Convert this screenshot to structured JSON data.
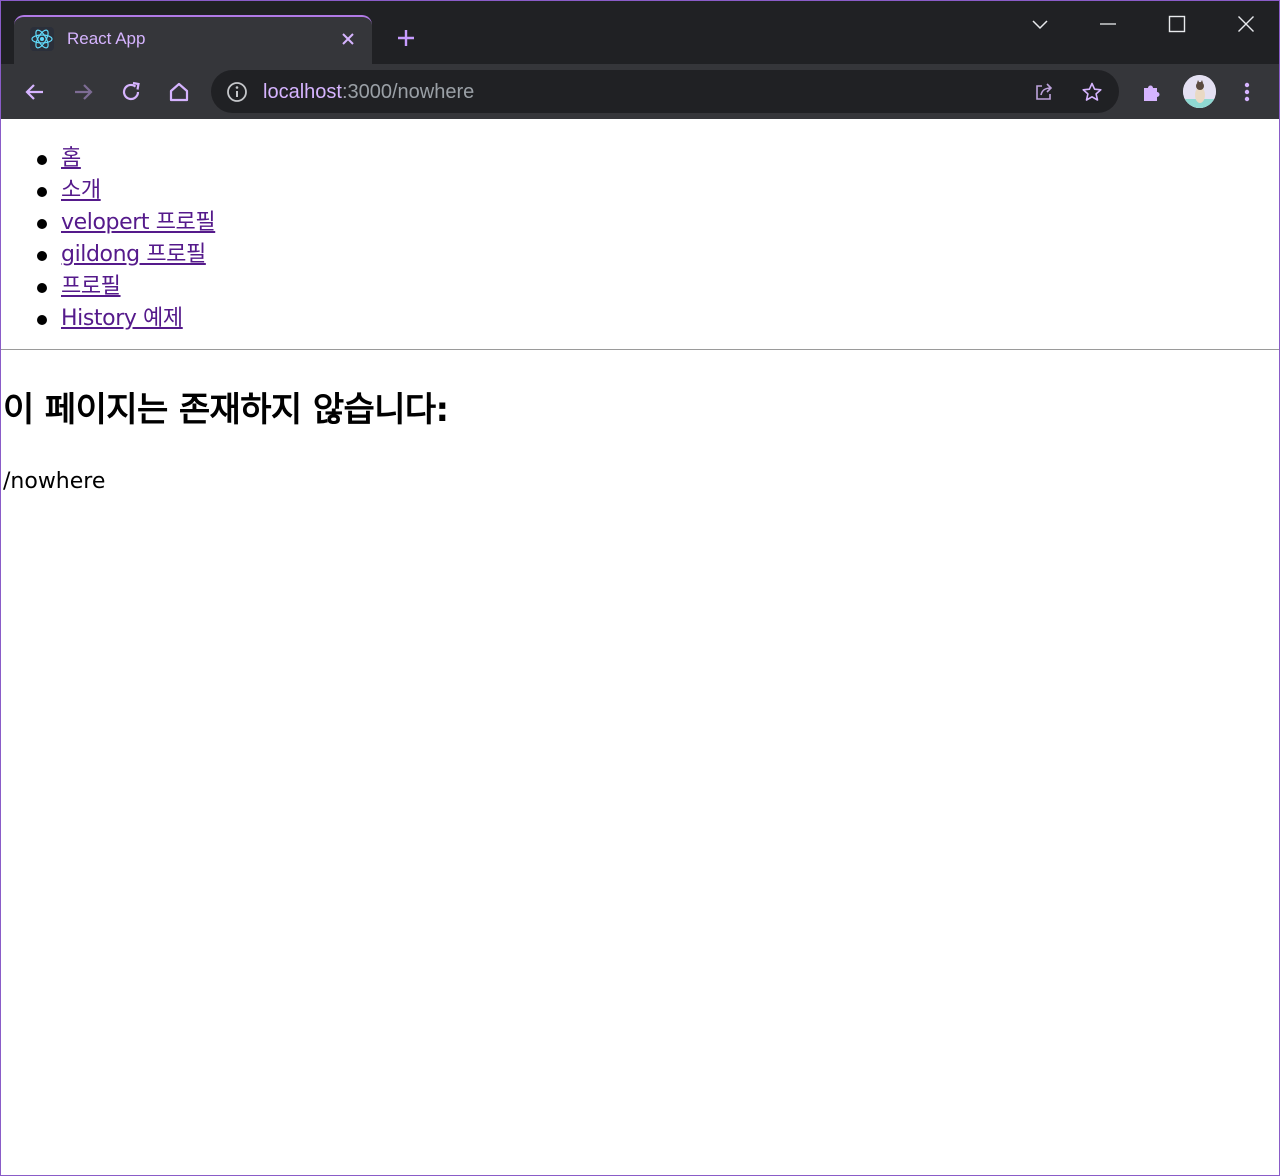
{
  "browser": {
    "tab": {
      "title": "React App",
      "favicon": "react-logo-icon"
    },
    "new_tab_icon": "plus-icon",
    "window_controls": [
      "tab-search-icon",
      "minimize-icon",
      "maximize-icon",
      "close-icon"
    ],
    "toolbar": {
      "url_host": "localhost",
      "url_rest": ":3000/nowhere",
      "icons": [
        "back-arrow-icon",
        "forward-arrow-icon",
        "reload-icon",
        "home-icon",
        "info-icon",
        "share-icon",
        "star-icon",
        "extensions-icon",
        "avatar",
        "more-menu-icon"
      ]
    },
    "colors": {
      "frame": "#202124",
      "toolbar": "#35363a",
      "accent": "#d6b4ff",
      "border": "#8a5cc8"
    }
  },
  "page": {
    "nav": [
      {
        "label": "홈"
      },
      {
        "label": "소개"
      },
      {
        "label": "velopert 프로필"
      },
      {
        "label": "gildong 프로필"
      },
      {
        "label": "프로필"
      },
      {
        "label": "History 예제"
      }
    ],
    "heading": "이 페이지는 존재하지 않습니다:",
    "path": "/nowhere",
    "link_color": "#551a8b"
  }
}
